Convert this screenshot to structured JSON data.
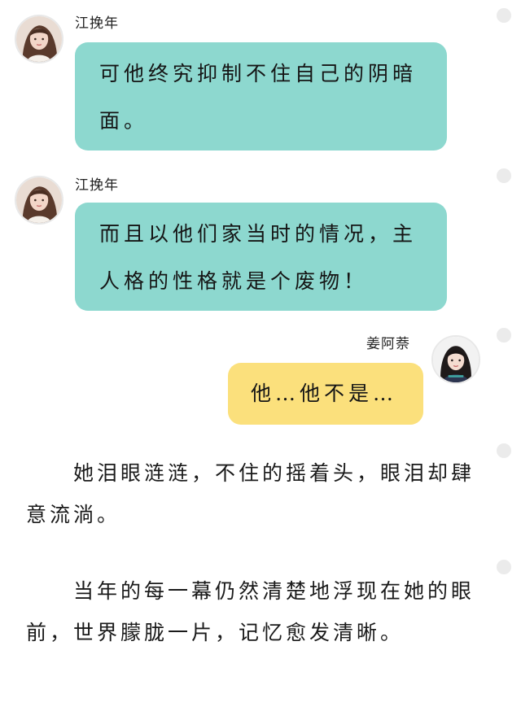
{
  "messages": [
    {
      "sender": "江挽年",
      "text": "可他终究抑制不住自己的阴暗面。",
      "side": "left",
      "bubble_color": "#8dd8cf"
    },
    {
      "sender": "江挽年",
      "text": "而且以他们家当时的情况，主人格的性格就是个废物！",
      "side": "left",
      "bubble_color": "#8dd8cf"
    },
    {
      "sender": "姜阿萘",
      "text": "他…他不是…",
      "side": "right",
      "bubble_color": "#fbe07c"
    }
  ],
  "narration": [
    "　　她泪眼涟涟，不住的摇着头，眼泪却肆意流淌。",
    "　　当年的每一幕仍然清楚地浮现在她的眼前，世界朦胧一片，记忆愈发清晰。"
  ],
  "side_marker_color": "#ebebeb"
}
